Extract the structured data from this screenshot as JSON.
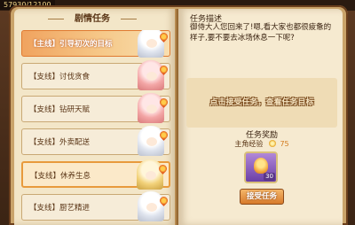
{
  "topbar": {
    "counter": "57930/12100"
  },
  "left_page": {
    "title": "剧情任务",
    "quests": [
      {
        "label": "【主线】引导初次的目标",
        "avatar": "white"
      },
      {
        "label": "【支线】讨伐贪食",
        "avatar": "pink"
      },
      {
        "label": "【支线】钻研天赋",
        "avatar": "pink"
      },
      {
        "label": "【支线】外卖配送",
        "avatar": "white"
      },
      {
        "label": "【支线】休养生息",
        "avatar": "gold"
      },
      {
        "label": "【支线】厨艺精进",
        "avatar": "white"
      }
    ]
  },
  "right_page": {
    "desc_title": "任务描述",
    "desc_text": "御侍大人您回来了!嗯,看大家也都很疲惫的样子,要不要去冰场休息一下呢?",
    "status_text": "点击接受任务，查看任务目标",
    "reward_title": "任务奖励",
    "exp_label": "主角经验",
    "exp_value": "75",
    "reward_item_count": "30",
    "accept_button": "接受任务"
  },
  "colors": {
    "selected": "#f0a35f",
    "accent": "#d27a1c"
  }
}
